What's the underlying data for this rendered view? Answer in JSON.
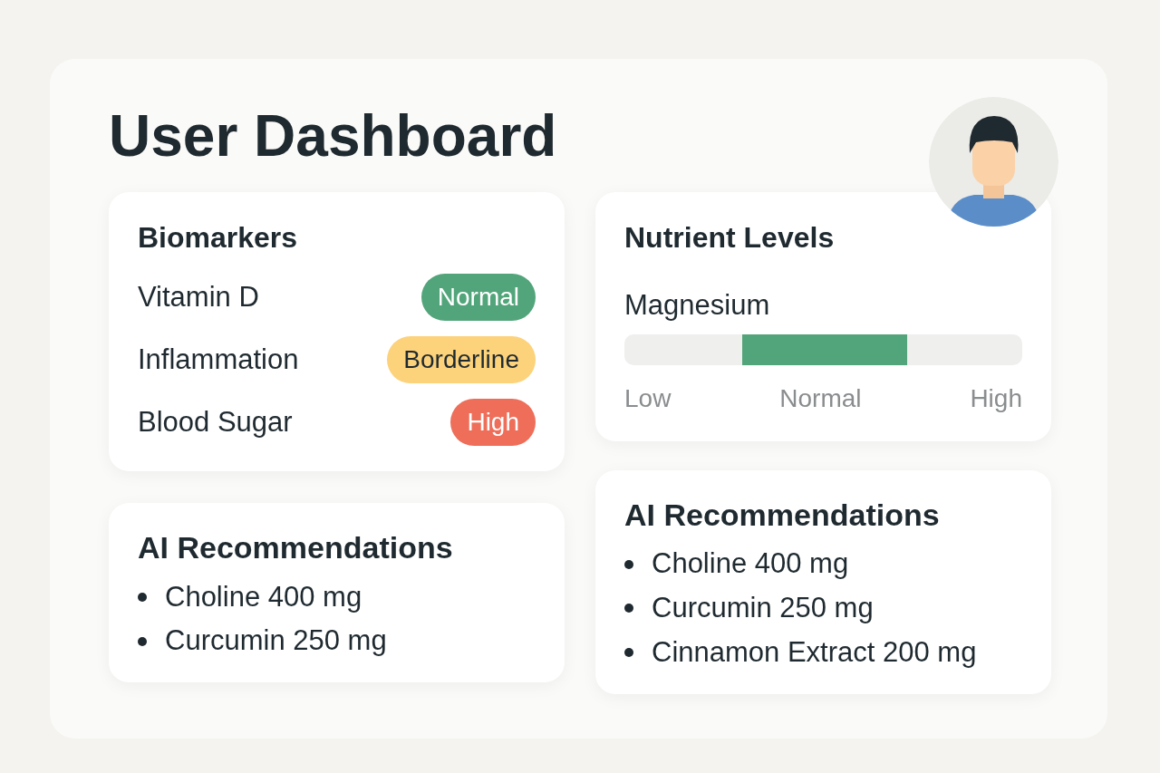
{
  "title": "User Dashboard",
  "biomarkers": {
    "title": "Biomarkers",
    "items": [
      {
        "name": "Vitamin D",
        "status": "Normal",
        "color": "#52a57a"
      },
      {
        "name": "Inflammation",
        "status": "Borderline",
        "color": "#fcd27b"
      },
      {
        "name": "Blood Sugar",
        "status": "High",
        "color": "#ee6e5a"
      }
    ]
  },
  "nutrients": {
    "title": "Nutrient Levels",
    "nutrient": "Magnesium",
    "scale": [
      "Low",
      "Normal",
      "High"
    ]
  },
  "recommendations_left": {
    "title": "AI Recommendations",
    "items": [
      "Choline 400 mg",
      "Curcumin 250 mg"
    ]
  },
  "recommendations_right": {
    "title": "AI Recommendations",
    "items": [
      "Choline 400 mg",
      "Curcumin 250 mg",
      "Cinnamon Extract 200 mg"
    ]
  }
}
